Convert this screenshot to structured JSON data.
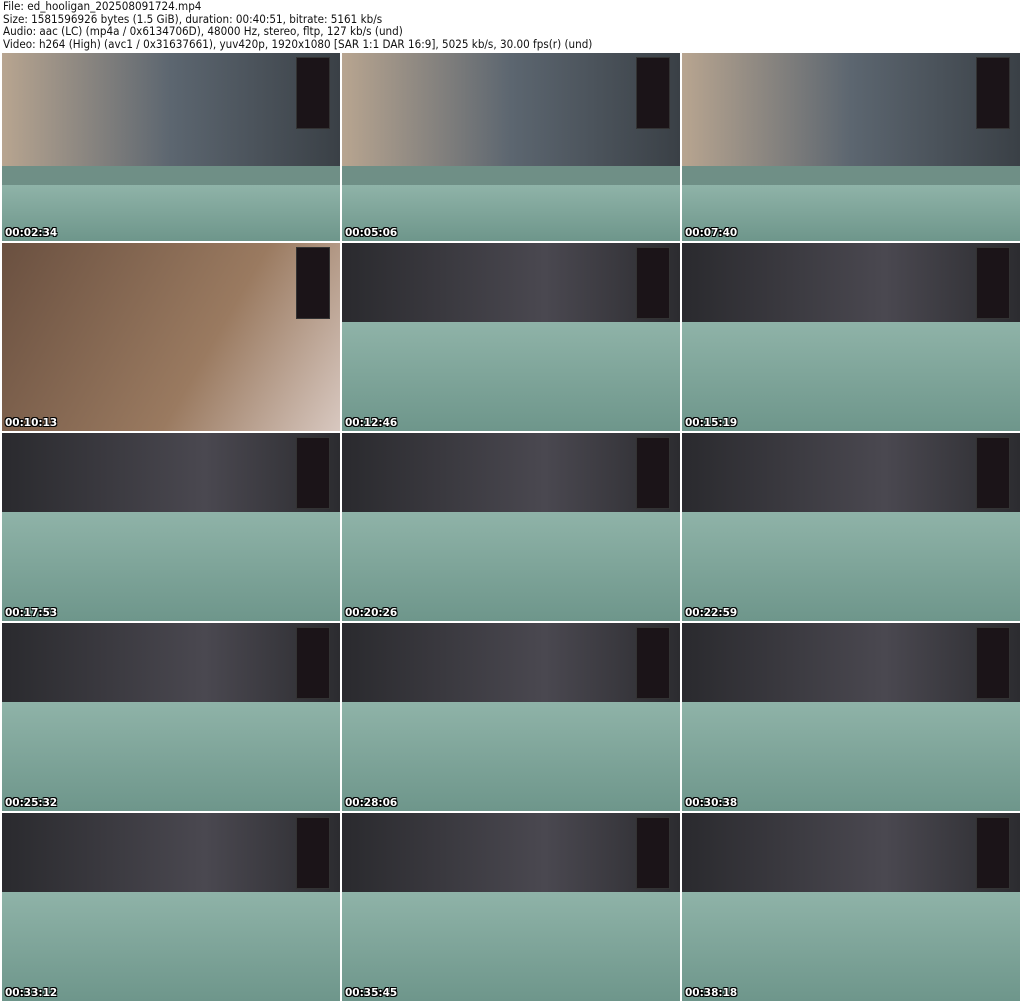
{
  "header": {
    "file": "File: ed_hooligan_202508091724.mp4",
    "size": "Size: 1581596926 bytes (1.5 GiB), duration: 00:40:51, bitrate: 5161 kb/s",
    "audio": "Audio: aac (LC) (mp4a / 0x6134706D), 48000 Hz, stereo, fltp, 127 kb/s (und)",
    "video": "Video: h264 (High) (avc1 / 0x31637661), yuv420p, 1920x1080 [SAR 1:1 DAR 16:9], 5025 kb/s, 30.00 fps(r) (und)"
  },
  "thumbnails": [
    {
      "timestamp": "00:02:34"
    },
    {
      "timestamp": "00:05:06"
    },
    {
      "timestamp": "00:07:40"
    },
    {
      "timestamp": "00:10:13"
    },
    {
      "timestamp": "00:12:46"
    },
    {
      "timestamp": "00:15:19"
    },
    {
      "timestamp": "00:17:53"
    },
    {
      "timestamp": "00:20:26"
    },
    {
      "timestamp": "00:22:59"
    },
    {
      "timestamp": "00:25:32"
    },
    {
      "timestamp": "00:28:06"
    },
    {
      "timestamp": "00:30:38"
    },
    {
      "timestamp": "00:33:12"
    },
    {
      "timestamp": "00:35:45"
    },
    {
      "timestamp": "00:38:18"
    }
  ]
}
